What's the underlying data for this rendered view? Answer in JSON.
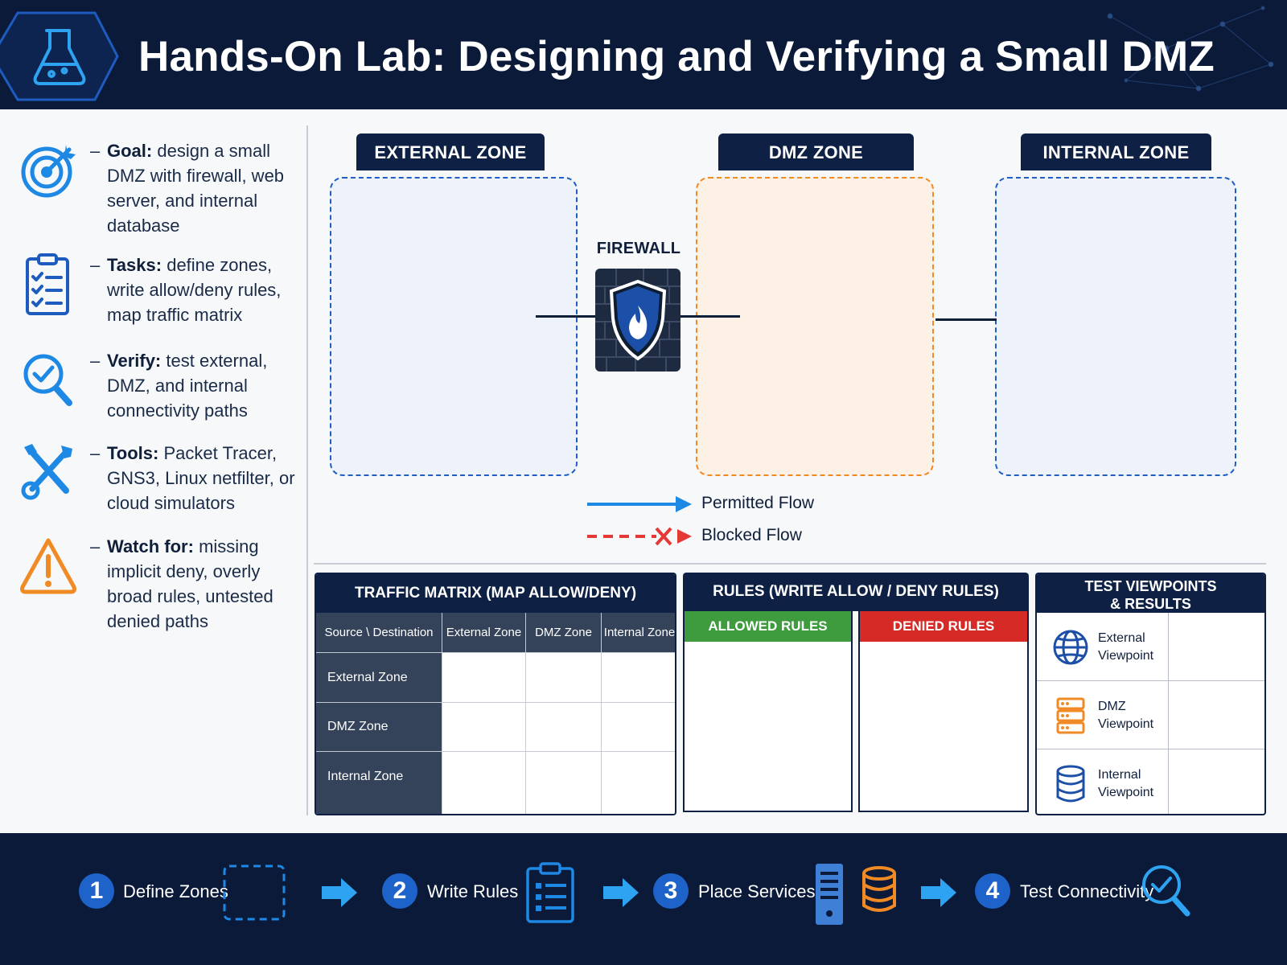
{
  "header": {
    "title": "Hands-On Lab: Designing and Verifying a Small DMZ",
    "logo_icon": "flask-icon"
  },
  "sidebar": {
    "items": [
      {
        "icon": "target-icon",
        "label": "Goal:",
        "text": "design a small DMZ with firewall, web server, and internal database"
      },
      {
        "icon": "clipboard-checklist-icon",
        "label": "Tasks:",
        "text": "define zones, write allow/deny rules, map traffic matrix"
      },
      {
        "icon": "magnifier-check-icon",
        "label": "Verify:",
        "text": "test external, DMZ, and internal connectivity paths"
      },
      {
        "icon": "wrench-screwdriver-icon",
        "label": "Tools:",
        "text": "Packet Tracer, GNS3, Linux netfilter, or cloud simulators"
      },
      {
        "icon": "warning-triangle-icon",
        "label": "Watch for:",
        "text": "missing implicit deny, overly broad rules, untested denied paths"
      }
    ]
  },
  "diagram": {
    "zones": {
      "external": "EXTERNAL ZONE",
      "dmz": "DMZ ZONE",
      "internal": "INTERNAL ZONE"
    },
    "firewall_label": "FIREWALL",
    "legend": {
      "permitted": "Permitted Flow",
      "blocked": "Blocked Flow"
    }
  },
  "traffic_matrix": {
    "title": "TRAFFIC MATRIX (MAP ALLOW/DENY)",
    "corner": "Source \\ Destination",
    "columns": [
      "External Zone",
      "DMZ Zone",
      "Internal Zone"
    ],
    "rows": [
      "External Zone",
      "DMZ Zone",
      "Internal Zone"
    ]
  },
  "rules": {
    "title": "RULES (WRITE ALLOW / DENY RULES)",
    "allowed": "ALLOWED RULES",
    "denied": "DENIED RULES"
  },
  "test_viewpoints": {
    "title_line1": "TEST VIEWPOINTS",
    "title_line2": "& RESULTS",
    "items": [
      {
        "icon": "globe-icon",
        "line1": "External",
        "line2": "Viewpoint"
      },
      {
        "icon": "server-rack-icon",
        "line1": "DMZ",
        "line2": "Viewpoint"
      },
      {
        "icon": "database-icon",
        "line1": "Internal",
        "line2": "Viewpoint"
      }
    ]
  },
  "steps": [
    {
      "num": "1",
      "label": "Define Zones"
    },
    {
      "num": "2",
      "label": "Write Rules"
    },
    {
      "num": "3",
      "label": "Place Services"
    },
    {
      "num": "4",
      "label": "Test Connectivity"
    }
  ],
  "colors": {
    "navy": "#0a1a38",
    "accent_blue": "#1e88e5",
    "dmz_orange": "#f08a24",
    "allowed_green": "#3e9b3e",
    "denied_red": "#d62a26"
  }
}
